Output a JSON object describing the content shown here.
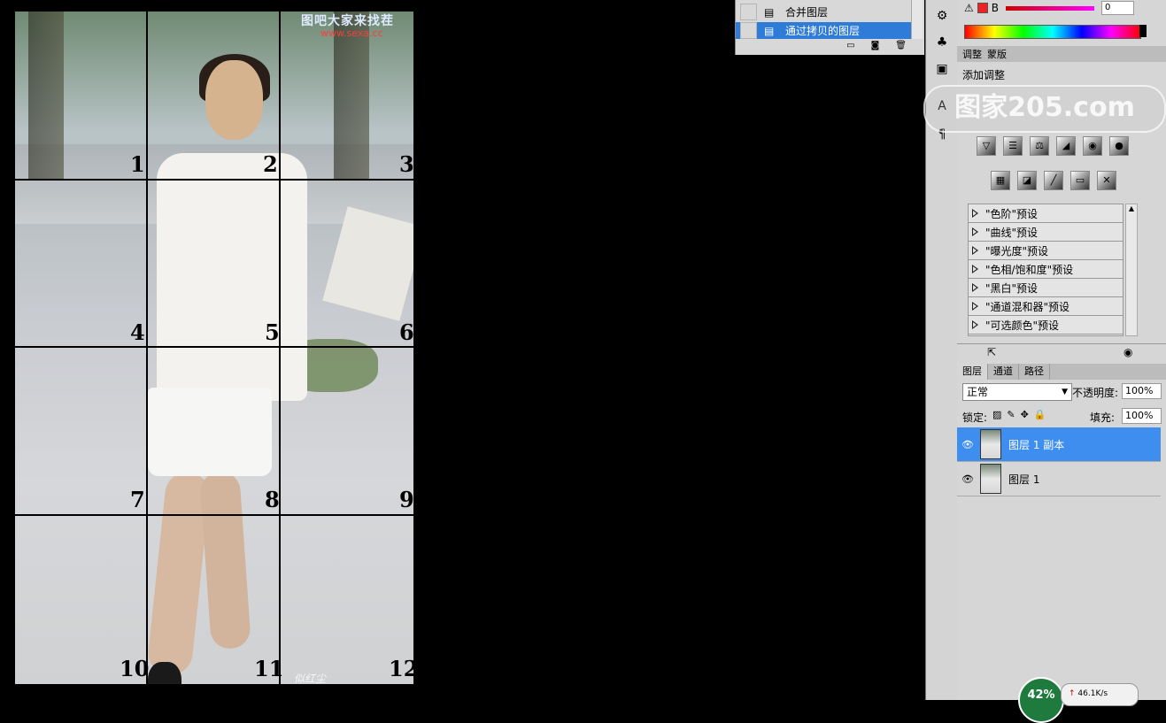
{
  "canvas": {
    "watermark_top": "图吧大家来找茬",
    "watermark_url": "www.sexa.cc",
    "watermark_bottom": "似红尘",
    "cell_numbers": [
      "1",
      "2",
      "3",
      "4",
      "5",
      "6",
      "7",
      "8",
      "9",
      "10",
      "11",
      "12"
    ]
  },
  "history": {
    "items": [
      {
        "label": "合并图层",
        "selected": false
      },
      {
        "label": "通过拷贝的图层",
        "selected": true
      }
    ]
  },
  "color_panel": {
    "channel_label": "B",
    "channel_value": "0"
  },
  "adjustments": {
    "tabs": [
      "调整",
      "蒙版"
    ],
    "title": "添加调整",
    "watermark": "图家205.com",
    "presets": [
      "\"色阶\"预设",
      "\"曲线\"预设",
      "\"曝光度\"预设",
      "\"色相/饱和度\"预设",
      "\"黑白\"预设",
      "\"通道混和器\"预设",
      "\"可选颜色\"预设"
    ]
  },
  "layers_panel": {
    "tabs": [
      "图层",
      "通道",
      "路径"
    ],
    "blend_mode": "正常",
    "opacity_label": "不透明度:",
    "opacity_value": "100%",
    "lock_label": "锁定:",
    "fill_label": "填充:",
    "fill_value": "100%",
    "layers": [
      {
        "name": "图层 1 副本",
        "selected": true
      },
      {
        "name": "图层 1",
        "selected": false
      }
    ]
  },
  "tray": {
    "cpu": "42%",
    "net_speed": "46.1K/s"
  },
  "colors": {
    "selection": "#3e8ef0",
    "panel_bg": "#d6d6d6",
    "canvas_bg": "#000000"
  }
}
